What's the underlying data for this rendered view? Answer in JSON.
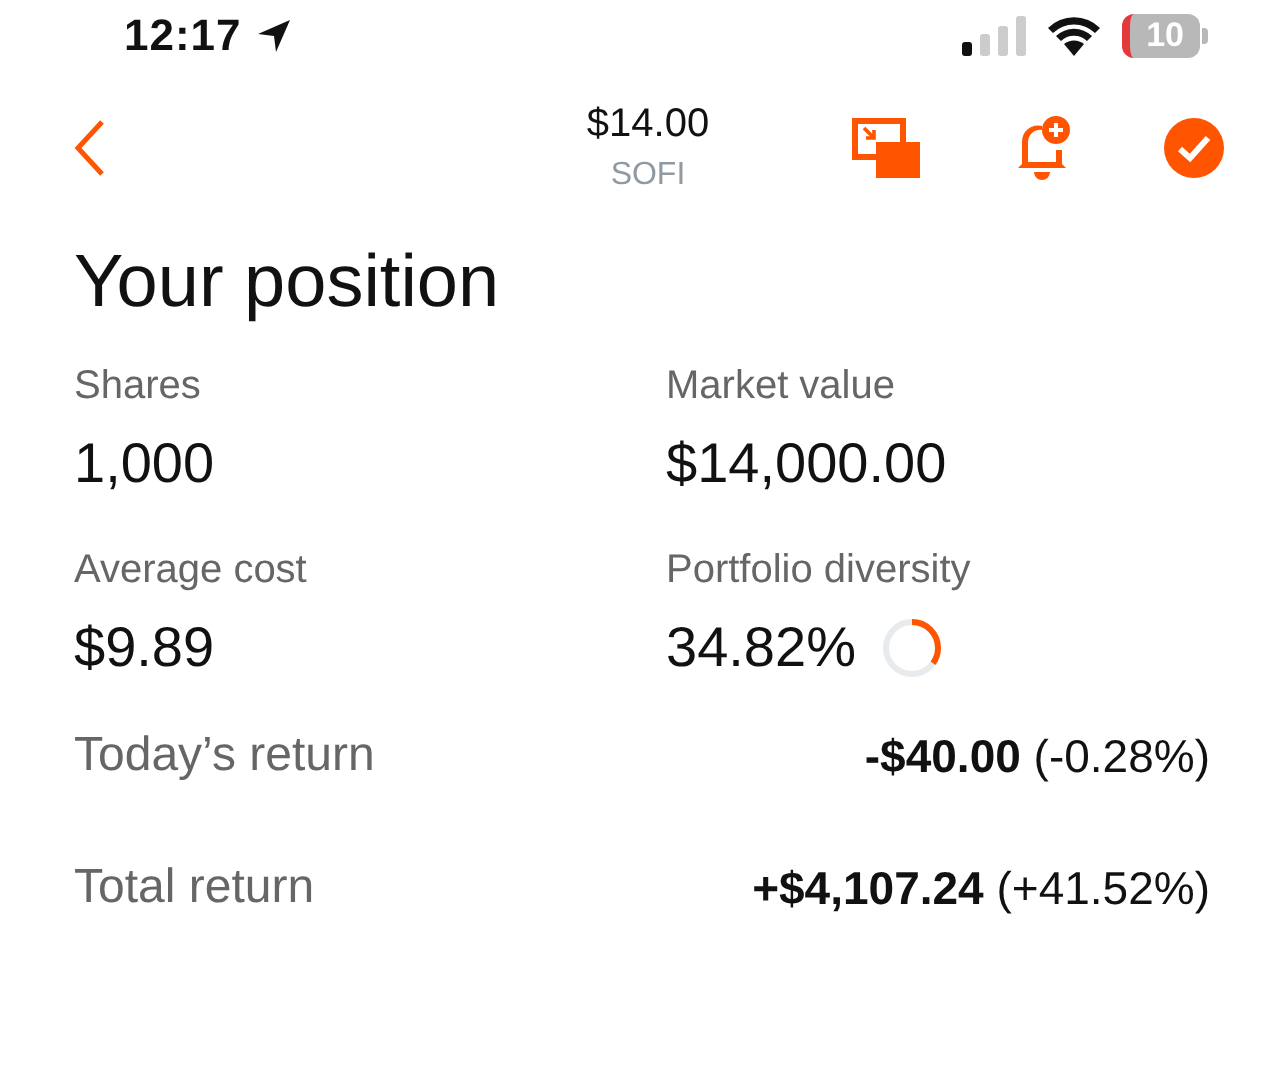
{
  "status_bar": {
    "time": "12:17",
    "battery": "10"
  },
  "nav": {
    "price": "$14.00",
    "ticker": "SOFI"
  },
  "title": "Your position",
  "stats": [
    {
      "label": "Shares",
      "value": "1,000"
    },
    {
      "label": "Market value",
      "value": "$14,000.00"
    },
    {
      "label": "Average cost",
      "value": "$9.89"
    },
    {
      "label": "Portfolio diversity",
      "value": "34.82%",
      "level": 0.3482
    }
  ],
  "returns": [
    {
      "label": "Today’s return",
      "amount": "-$40.00",
      "percent": "(-0.28%)"
    },
    {
      "label": "Total return",
      "amount": "+$4,107.24",
      "percent": "(+41.52%)"
    }
  ]
}
